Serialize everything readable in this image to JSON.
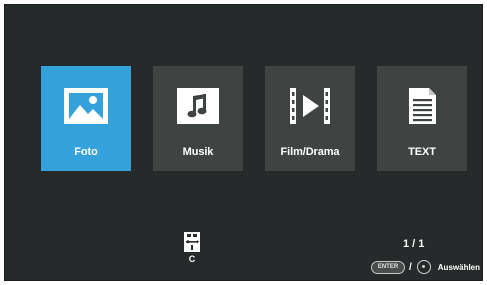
{
  "menu": {
    "tiles": [
      {
        "label": "Foto",
        "icon": "photo-icon",
        "selected": true
      },
      {
        "label": "Musik",
        "icon": "music-note-icon",
        "selected": false
      },
      {
        "label": "Film/Drama",
        "icon": "film-play-icon",
        "selected": false
      },
      {
        "label": "TEXT",
        "icon": "text-document-icon",
        "selected": false
      }
    ]
  },
  "source": {
    "label": "C",
    "icon": "usb-drive-icon"
  },
  "footer": {
    "page_counter": "1 / 1",
    "enter_key_label": "ENTER",
    "separator": "/",
    "select_hint": "Auswählen"
  },
  "colors": {
    "background": "#262a2a",
    "tile": "#3f4443",
    "tile_selected": "#35a1db"
  }
}
